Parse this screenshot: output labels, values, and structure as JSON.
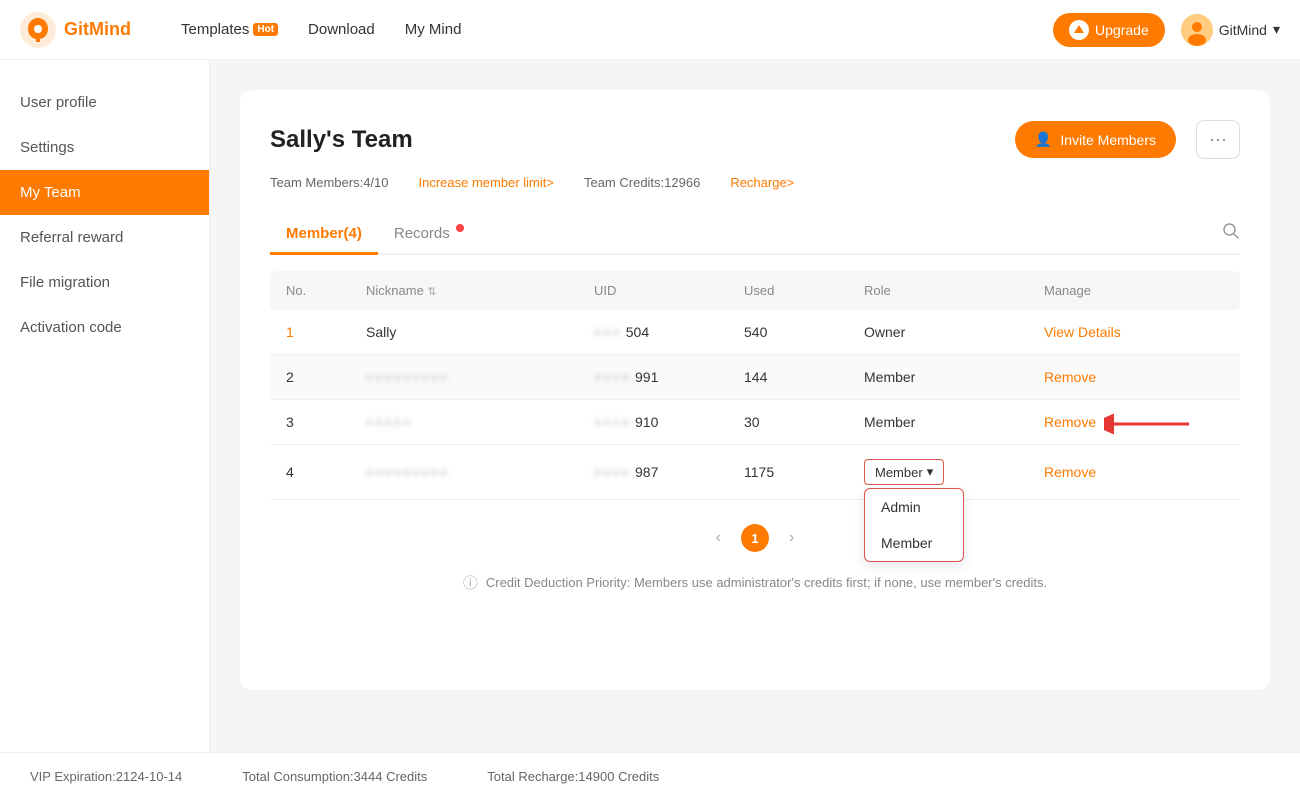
{
  "header": {
    "logo_text": "GitMind",
    "nav": [
      {
        "label": "Templates",
        "badge": "Hot",
        "name": "templates"
      },
      {
        "label": "Download",
        "name": "download"
      },
      {
        "label": "My Mind",
        "name": "mymind"
      }
    ],
    "upgrade_label": "Upgrade",
    "user_label": "GitMind"
  },
  "sidebar": {
    "items": [
      {
        "label": "User profile",
        "name": "user-profile",
        "active": false
      },
      {
        "label": "Settings",
        "name": "settings",
        "active": false
      },
      {
        "label": "My Team",
        "name": "my-team",
        "active": true
      },
      {
        "label": "Referral reward",
        "name": "referral-reward",
        "active": false
      },
      {
        "label": "File migration",
        "name": "file-migration",
        "active": false
      },
      {
        "label": "Activation code",
        "name": "activation-code",
        "active": false
      }
    ]
  },
  "main": {
    "team_title": "Sally's Team",
    "invite_btn": "Invite Members",
    "team_members_text": "Team Members:4/10",
    "increase_limit_link": "Increase member limit>",
    "team_credits_text": "Team Credits:12966",
    "recharge_link": "Recharge>",
    "tabs": [
      {
        "label": "Member(4)",
        "active": true,
        "badge": false
      },
      {
        "label": "Records",
        "active": false,
        "badge": true
      }
    ],
    "table": {
      "headers": [
        "No.",
        "Nickname ↕",
        "UID",
        "Used",
        "Role",
        "Manage"
      ],
      "rows": [
        {
          "no": "1",
          "nickname": "Sally",
          "nickname_blurred": false,
          "uid": "504",
          "uid_blurred": true,
          "uid_prefix": "●●●●●",
          "used": "540",
          "role": "Owner",
          "manage": "View Details",
          "manage_type": "link",
          "role_dropdown": false
        },
        {
          "no": "2",
          "nickname": "●●●●●●●●",
          "nickname_blurred": true,
          "uid": "991",
          "uid_blurred": true,
          "uid_prefix": "●●●●",
          "used": "144",
          "role": "Member",
          "manage": "Remove",
          "manage_type": "remove",
          "role_dropdown": false
        },
        {
          "no": "3",
          "nickname": "●●●●●",
          "nickname_blurred": true,
          "uid": "910",
          "uid_blurred": true,
          "uid_prefix": "●●●●",
          "used": "30",
          "role": "Member",
          "manage": "Remove",
          "manage_type": "remove",
          "role_dropdown": false
        },
        {
          "no": "4",
          "nickname": "●●●●●●●●●",
          "nickname_blurred": true,
          "uid": "987",
          "uid_blurred": true,
          "uid_prefix": "●●●●",
          "used": "1175",
          "role": "Member",
          "manage": "Remove",
          "manage_type": "remove",
          "role_dropdown": true
        }
      ]
    },
    "role_dropdown": {
      "options": [
        "Admin",
        "Member"
      ]
    },
    "pagination": {
      "prev": "<",
      "current": "1",
      "next": ">"
    },
    "credit_note": "Credit Deduction Priority: Members use administrator's credits first; if none, use member's credits.",
    "footer": {
      "vip_expiration": "VIP Expiration:2124-10-14",
      "total_consumption": "Total Consumption:3444 Credits",
      "total_recharge": "Total Recharge:14900 Credits"
    }
  }
}
